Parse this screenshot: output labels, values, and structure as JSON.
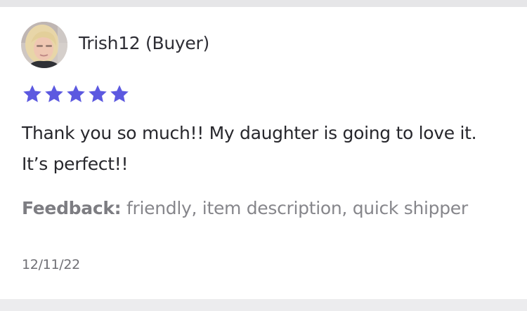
{
  "review": {
    "reviewer_name": "Trish12 (Buyer)",
    "rating": 5,
    "rating_max": 5,
    "star_color": "#5c59e0",
    "text": "Thank you so much!! My daughter is going to love it. It’s perfect!!",
    "feedback_label": "Feedback:",
    "feedback_tags": "friendly, item description, quick shipper",
    "date": "12/11/22"
  }
}
